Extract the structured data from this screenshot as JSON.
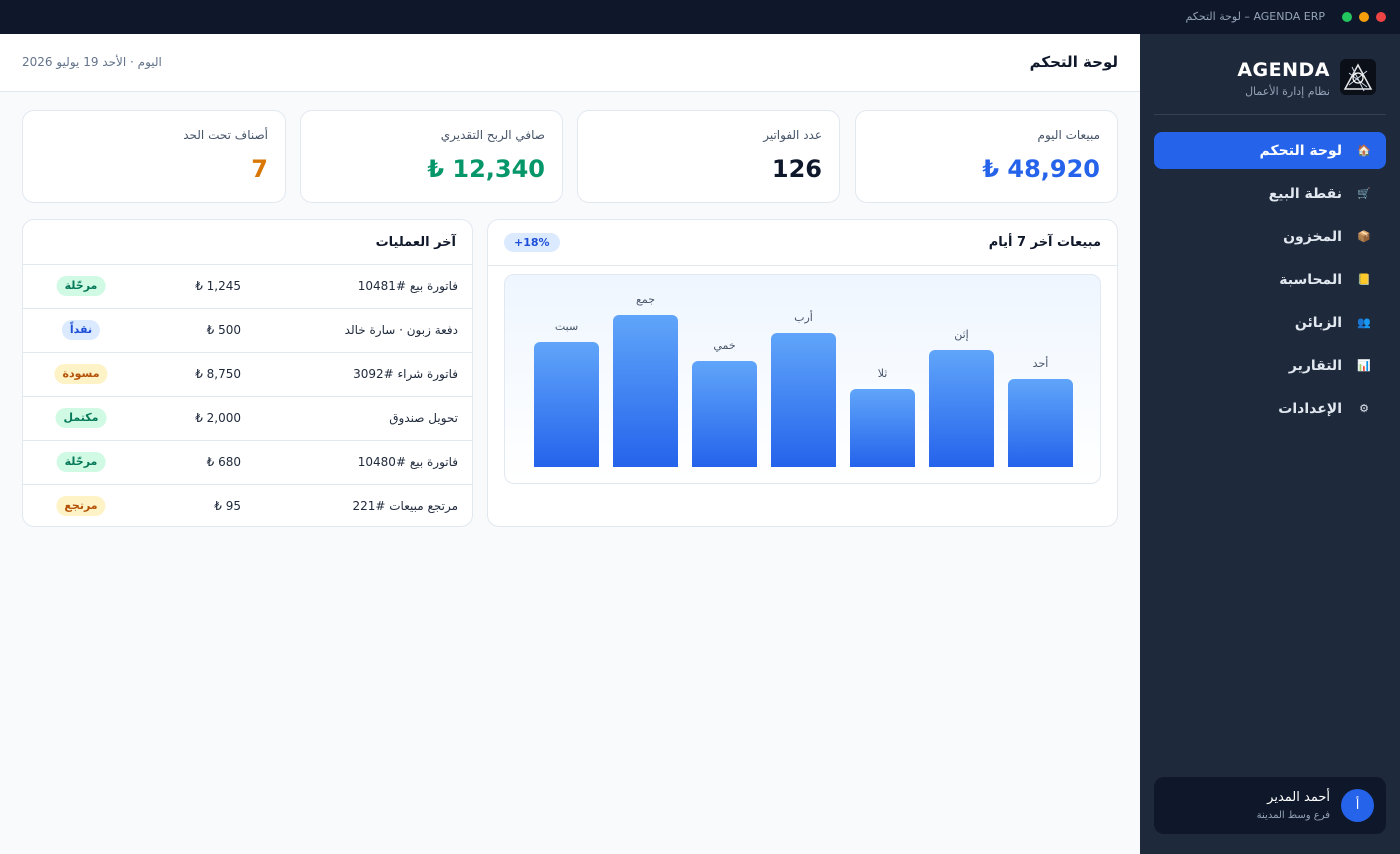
{
  "window": {
    "title": "AGENDA ERP – لوحة التحكم",
    "controls": [
      {
        "name": "close",
        "color": "#ef4444"
      },
      {
        "name": "minimize",
        "color": "#f59e0b"
      },
      {
        "name": "maximize",
        "color": "#22c55e"
      }
    ]
  },
  "sidebar": {
    "brand": "AGENDA",
    "brand_sub": "نظام إدارة الأعمال",
    "items": [
      {
        "label": "لوحة التحكم",
        "icon": "home-icon",
        "glyph": "🏠",
        "active": true
      },
      {
        "label": "نقطة البيع",
        "icon": "cash-register-icon",
        "glyph": "🛒",
        "active": false
      },
      {
        "label": "المخزون",
        "icon": "box-icon",
        "glyph": "📦",
        "active": false
      },
      {
        "label": "المحاسبة",
        "icon": "ledger-icon",
        "glyph": "📒",
        "active": false
      },
      {
        "label": "الزبائن",
        "icon": "users-icon",
        "glyph": "👥",
        "active": false
      },
      {
        "label": "التقارير",
        "icon": "chart-icon",
        "glyph": "📊",
        "active": false
      },
      {
        "label": "الإعدادات",
        "icon": "gear-icon",
        "glyph": "⚙",
        "active": false
      }
    ],
    "user": {
      "initial": "أ",
      "name": "أحمد المدير",
      "branch": "فرع وسط المدينة"
    }
  },
  "header": {
    "title": "لوحة التحكم",
    "today": "اليوم · الأحد 19 يوليو 2026"
  },
  "kpis": [
    {
      "label": "مبيعات اليوم",
      "value": "₺ 48,920",
      "color": "#2563eb"
    },
    {
      "label": "عدد الفواتير",
      "value": "126",
      "color": "#0f172a"
    },
    {
      "label": "صافي الربح التقديري",
      "value": "₺ 12,340",
      "color": "#059669"
    },
    {
      "label": "أصناف تحت الحد",
      "value": "7",
      "color": "#d97706"
    }
  ],
  "sales_card": {
    "title": "مبيعات آخر 7 أيام",
    "change": "+18%"
  },
  "chart_data": {
    "type": "bar",
    "categories": [
      "أحد",
      "إثن",
      "ثلا",
      "أرب",
      "خمي",
      "جمع",
      "سبت"
    ],
    "values": [
      55,
      73,
      49,
      84,
      66,
      95,
      78
    ],
    "ylim": [
      0,
      100
    ],
    "grid": false,
    "legend": "none",
    "colors": {
      "top": "#60a5fa",
      "bottom": "#2563eb"
    }
  },
  "ops_card": {
    "title": "آخر العمليات",
    "rows": [
      {
        "desc": "فاتورة بيع #10481",
        "amount": "₺ 1,245",
        "status": "مرحّلة",
        "status_bg": "#d1fae5",
        "status_fg": "#047857"
      },
      {
        "desc": "دفعة زبون · سارة خالد",
        "amount": "₺ 500",
        "status": "نقداً",
        "status_bg": "#dbeafe",
        "status_fg": "#1d4ed8"
      },
      {
        "desc": "فاتورة شراء #3092",
        "amount": "₺ 8,750",
        "status": "مسودة",
        "status_bg": "#fef3c7",
        "status_fg": "#b45309"
      },
      {
        "desc": "تحويل صندوق",
        "amount": "₺ 2,000",
        "status": "مكتمل",
        "status_bg": "#d1fae5",
        "status_fg": "#047857"
      },
      {
        "desc": "فاتورة بيع #10480",
        "amount": "₺ 680",
        "status": "مرحّلة",
        "status_bg": "#d1fae5",
        "status_fg": "#047857"
      },
      {
        "desc": "مرتجع مبيعات #221",
        "amount": "₺ 95",
        "status": "مرتجع",
        "status_bg": "#fef3c7",
        "status_fg": "#b45309"
      }
    ]
  }
}
